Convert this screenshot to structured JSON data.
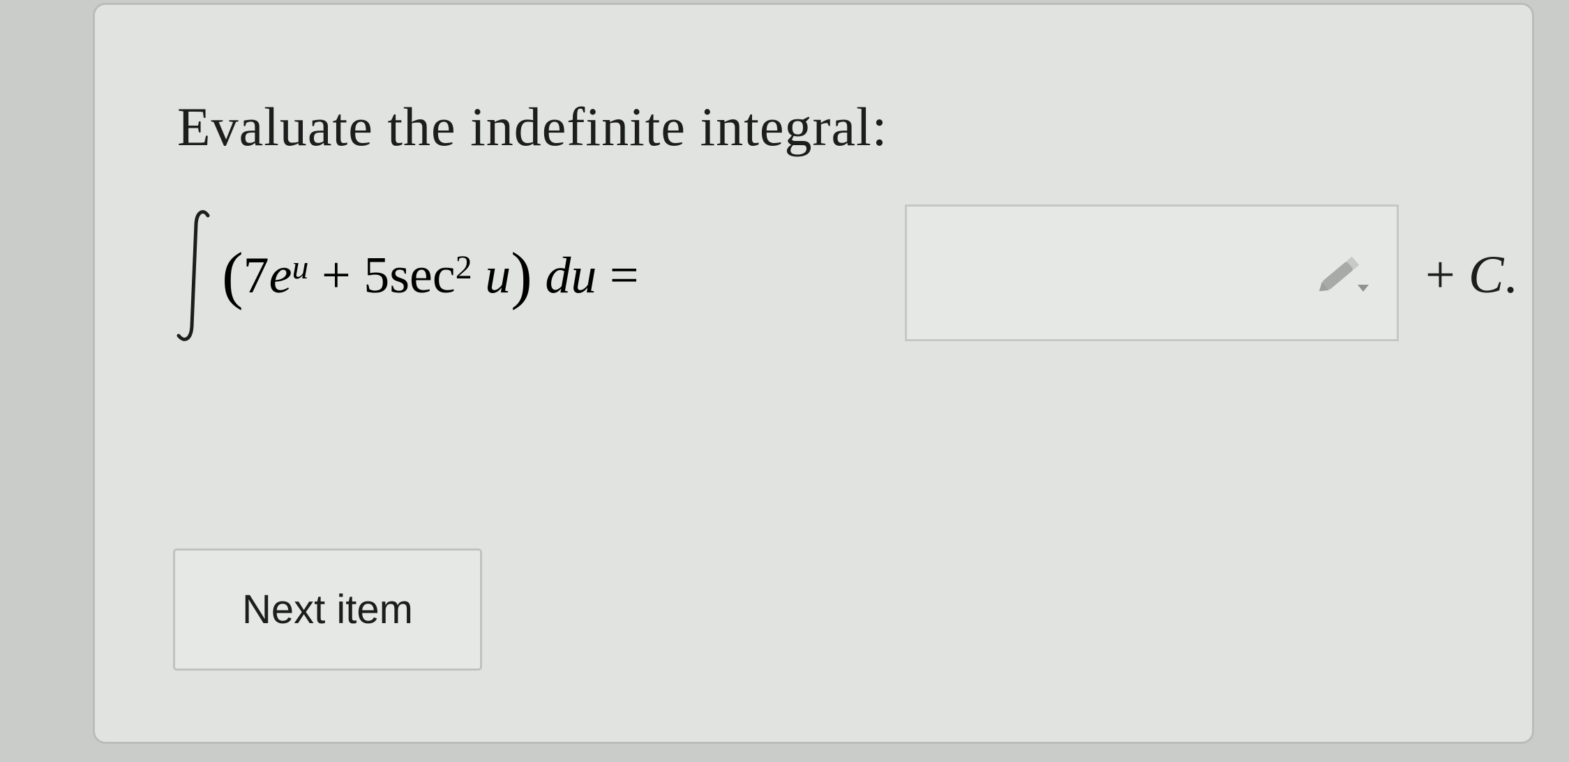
{
  "question": {
    "prompt": "Evaluate the indefinite integral:",
    "integrand": {
      "coef1": "7",
      "base": "e",
      "exponent1": "u",
      "plus": " + ",
      "coef2": "5",
      "func": "sec",
      "exponent2": "2",
      "arg": "u",
      "differential": "du",
      "equals": " = "
    },
    "answer": {
      "value": "",
      "placeholder": "",
      "icon": "pencil-icon"
    },
    "constant": {
      "plus": "+ ",
      "symbol": "C",
      "period": "."
    }
  },
  "actions": {
    "next_label": "Next item"
  },
  "colors": {
    "background": "#c9ccc9",
    "card": "#e1e3e0",
    "border": "#b9bcba",
    "text": "#1d1d1d"
  }
}
